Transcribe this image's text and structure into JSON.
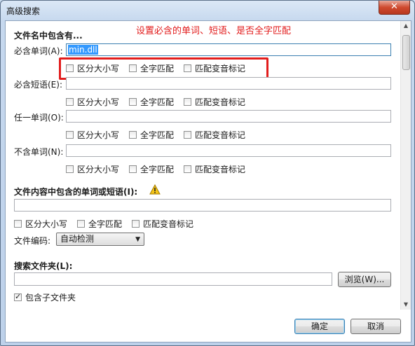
{
  "window": {
    "title": "高级搜索",
    "close_glyph": "✕"
  },
  "annotation": {
    "text": "设置必含的单词、短语、是否全字匹配",
    "color": "#e21d1d"
  },
  "filename_section": {
    "heading": "文件名中包含有...",
    "rows": [
      {
        "label": "必含单词(A):",
        "value": "min.dll"
      },
      {
        "label": "必含短语(E):",
        "value": ""
      },
      {
        "label": "任一单词(O):",
        "value": ""
      },
      {
        "label": "不含单词(N):",
        "value": ""
      }
    ],
    "options": [
      "区分大小写",
      "全字匹配",
      "匹配变音标记"
    ]
  },
  "content_section": {
    "heading": "文件内容中包含的单词或短语(I):",
    "warning_icon": "warning-icon",
    "value": "",
    "options": [
      "区分大小写",
      "全字匹配",
      "匹配变音标记"
    ],
    "encoding_label": "文件编码:",
    "encoding_value": "自动检测"
  },
  "folder_section": {
    "heading": "搜索文件夹(L):",
    "value": "",
    "browse_label": "浏览(W)...",
    "subfolders_label": "包含子文件夹",
    "subfolders_checked": true
  },
  "footer": {
    "ok_label": "确定",
    "cancel_label": "取消"
  }
}
